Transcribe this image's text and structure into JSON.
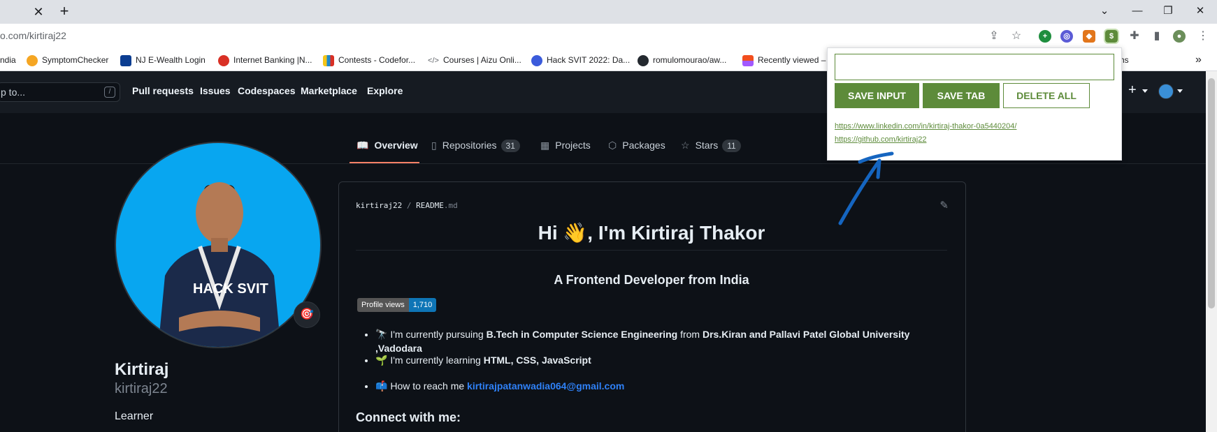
{
  "browser": {
    "url": "o.com/kirtiraj22",
    "tab_close_glyph": "✕",
    "new_tab_glyph": "+",
    "window_controls": [
      "⌄",
      "—",
      "❐",
      "✕"
    ],
    "bookmarks": [
      {
        "label": "ndia",
        "color": "#1a73e8"
      },
      {
        "label": "SymptomChecker",
        "color": "#f5a623"
      },
      {
        "label": "NJ E-Wealth Login",
        "color": "#0b3d91"
      },
      {
        "label": "Internet Banking |N...",
        "color": "#d93025"
      },
      {
        "label": "Contests - Codefor...",
        "color": "#1f8acb"
      },
      {
        "label": "Courses | Aizu Onli...",
        "color": "#5f6368"
      },
      {
        "label": "Hack SVIT 2022: Da...",
        "color": "#3b5bdb"
      },
      {
        "label": "romulomourao/aw...",
        "color": "#24292f"
      },
      {
        "label": "Recently viewed – F",
        "color": "#f24e1e"
      }
    ],
    "bookmark_tail": "hs",
    "overflow_glyph": "»"
  },
  "github": {
    "search_placeholder": "p to...",
    "search_key": "/",
    "nav": [
      "Pull requests",
      "Issues",
      "Codespaces",
      "Marketplace",
      "Explore"
    ],
    "plus_glyph": "+",
    "tabs": [
      {
        "label": "Overview",
        "icon": "📖",
        "count": ""
      },
      {
        "label": "Repositories",
        "icon": "▯",
        "count": "31"
      },
      {
        "label": "Projects",
        "icon": "▦",
        "count": ""
      },
      {
        "label": "Packages",
        "icon": "⬡",
        "count": ""
      },
      {
        "label": "Stars",
        "icon": "☆",
        "count": "11"
      }
    ],
    "profile": {
      "name": "Kirtiraj",
      "login": "kirtiraj22",
      "bio": "Learner",
      "shirt_text": "HACK SVIT",
      "status_icon": "🎯"
    },
    "readme": {
      "owner": "kirtiraj22",
      "sep": " / ",
      "file": "README",
      "ext": ".md",
      "edit_icon": "✎",
      "heading": "Hi 👋, I'm Kirtiraj Thakor",
      "subheading": "A Frontend Developer from India",
      "views_label": "Profile views",
      "views_value": "1,710",
      "list": [
        {
          "emoji": "🔭",
          "pre": "I'm currently pursuing ",
          "b1": "B.Tech in Computer Science Engineering",
          "mid": " from ",
          "b2": "Drs.Kiran and Pallavi Patel Global University ,Vadodara"
        },
        {
          "emoji": "🌱",
          "pre": "I'm currently learning ",
          "b1": "HTML, CSS, JavaScript"
        },
        {
          "emoji": "📫",
          "pre": "How to reach me ",
          "link": "kirtirajpatanwadia064@gmail.com"
        }
      ],
      "connect": "Connect with me:"
    }
  },
  "popup": {
    "input_value": "",
    "buttons": [
      "SAVE INPUT",
      "SAVE TAB",
      "DELETE ALL"
    ],
    "links": [
      "https://www.linkedin.com/in/kirtiraj-thakor-0a5440204/",
      "https://github.com/kirtiraj22"
    ],
    "accent": "#5d8b3a"
  },
  "colors": {
    "gh_bg": "#0d1117",
    "gh_header": "#161b22",
    "arrow": "#1565c0"
  }
}
